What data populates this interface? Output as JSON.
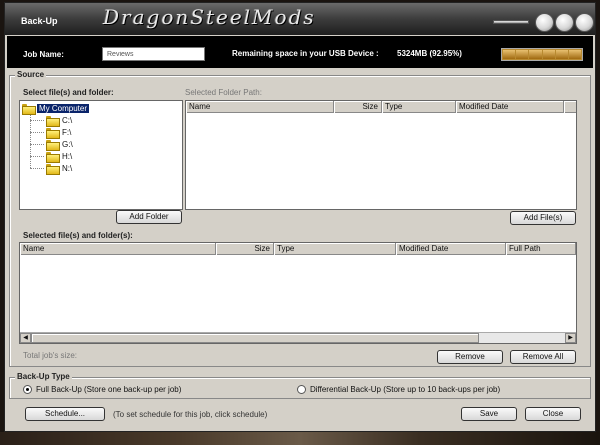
{
  "window": {
    "title": "Back-Up",
    "brand": "DragonSteelMods"
  },
  "top": {
    "job_label": "Job Name:",
    "job_value": "Reviews",
    "space_label": "Remaining space in your USB Device :",
    "space_value": "5324MB (92.95%)",
    "usb_fill_percent": 92.95
  },
  "source": {
    "legend": "Source",
    "select_label": "Select file(s) and folder:",
    "folder_path_label": "Selected Folder Path:",
    "tree": {
      "root": "My Computer",
      "drives": [
        "C:\\",
        "F:\\",
        "G:\\",
        "H:\\",
        "N:\\"
      ]
    },
    "folder_columns": [
      "Name",
      "Size",
      "Type",
      "Modified Date"
    ],
    "add_folder": "Add Folder",
    "add_files": "Add File(s)",
    "selected_label": "Selected file(s) and folder(s):",
    "selected_columns": [
      "Name",
      "Size",
      "Type",
      "Modified Date",
      "Full Path"
    ],
    "total_size_label": "Total job's size:",
    "remove": "Remove",
    "remove_all": "Remove All"
  },
  "backup_type": {
    "legend": "Back-Up Type",
    "full": "Full Back-Up (Store one back-up per job)",
    "differential": "Differential Back-Up (Store up to 10 back-ups per job)",
    "selected": "full"
  },
  "footer": {
    "schedule": "Schedule...",
    "schedule_hint": "(To set schedule for this job, click schedule)",
    "save": "Save",
    "close": "Close"
  }
}
